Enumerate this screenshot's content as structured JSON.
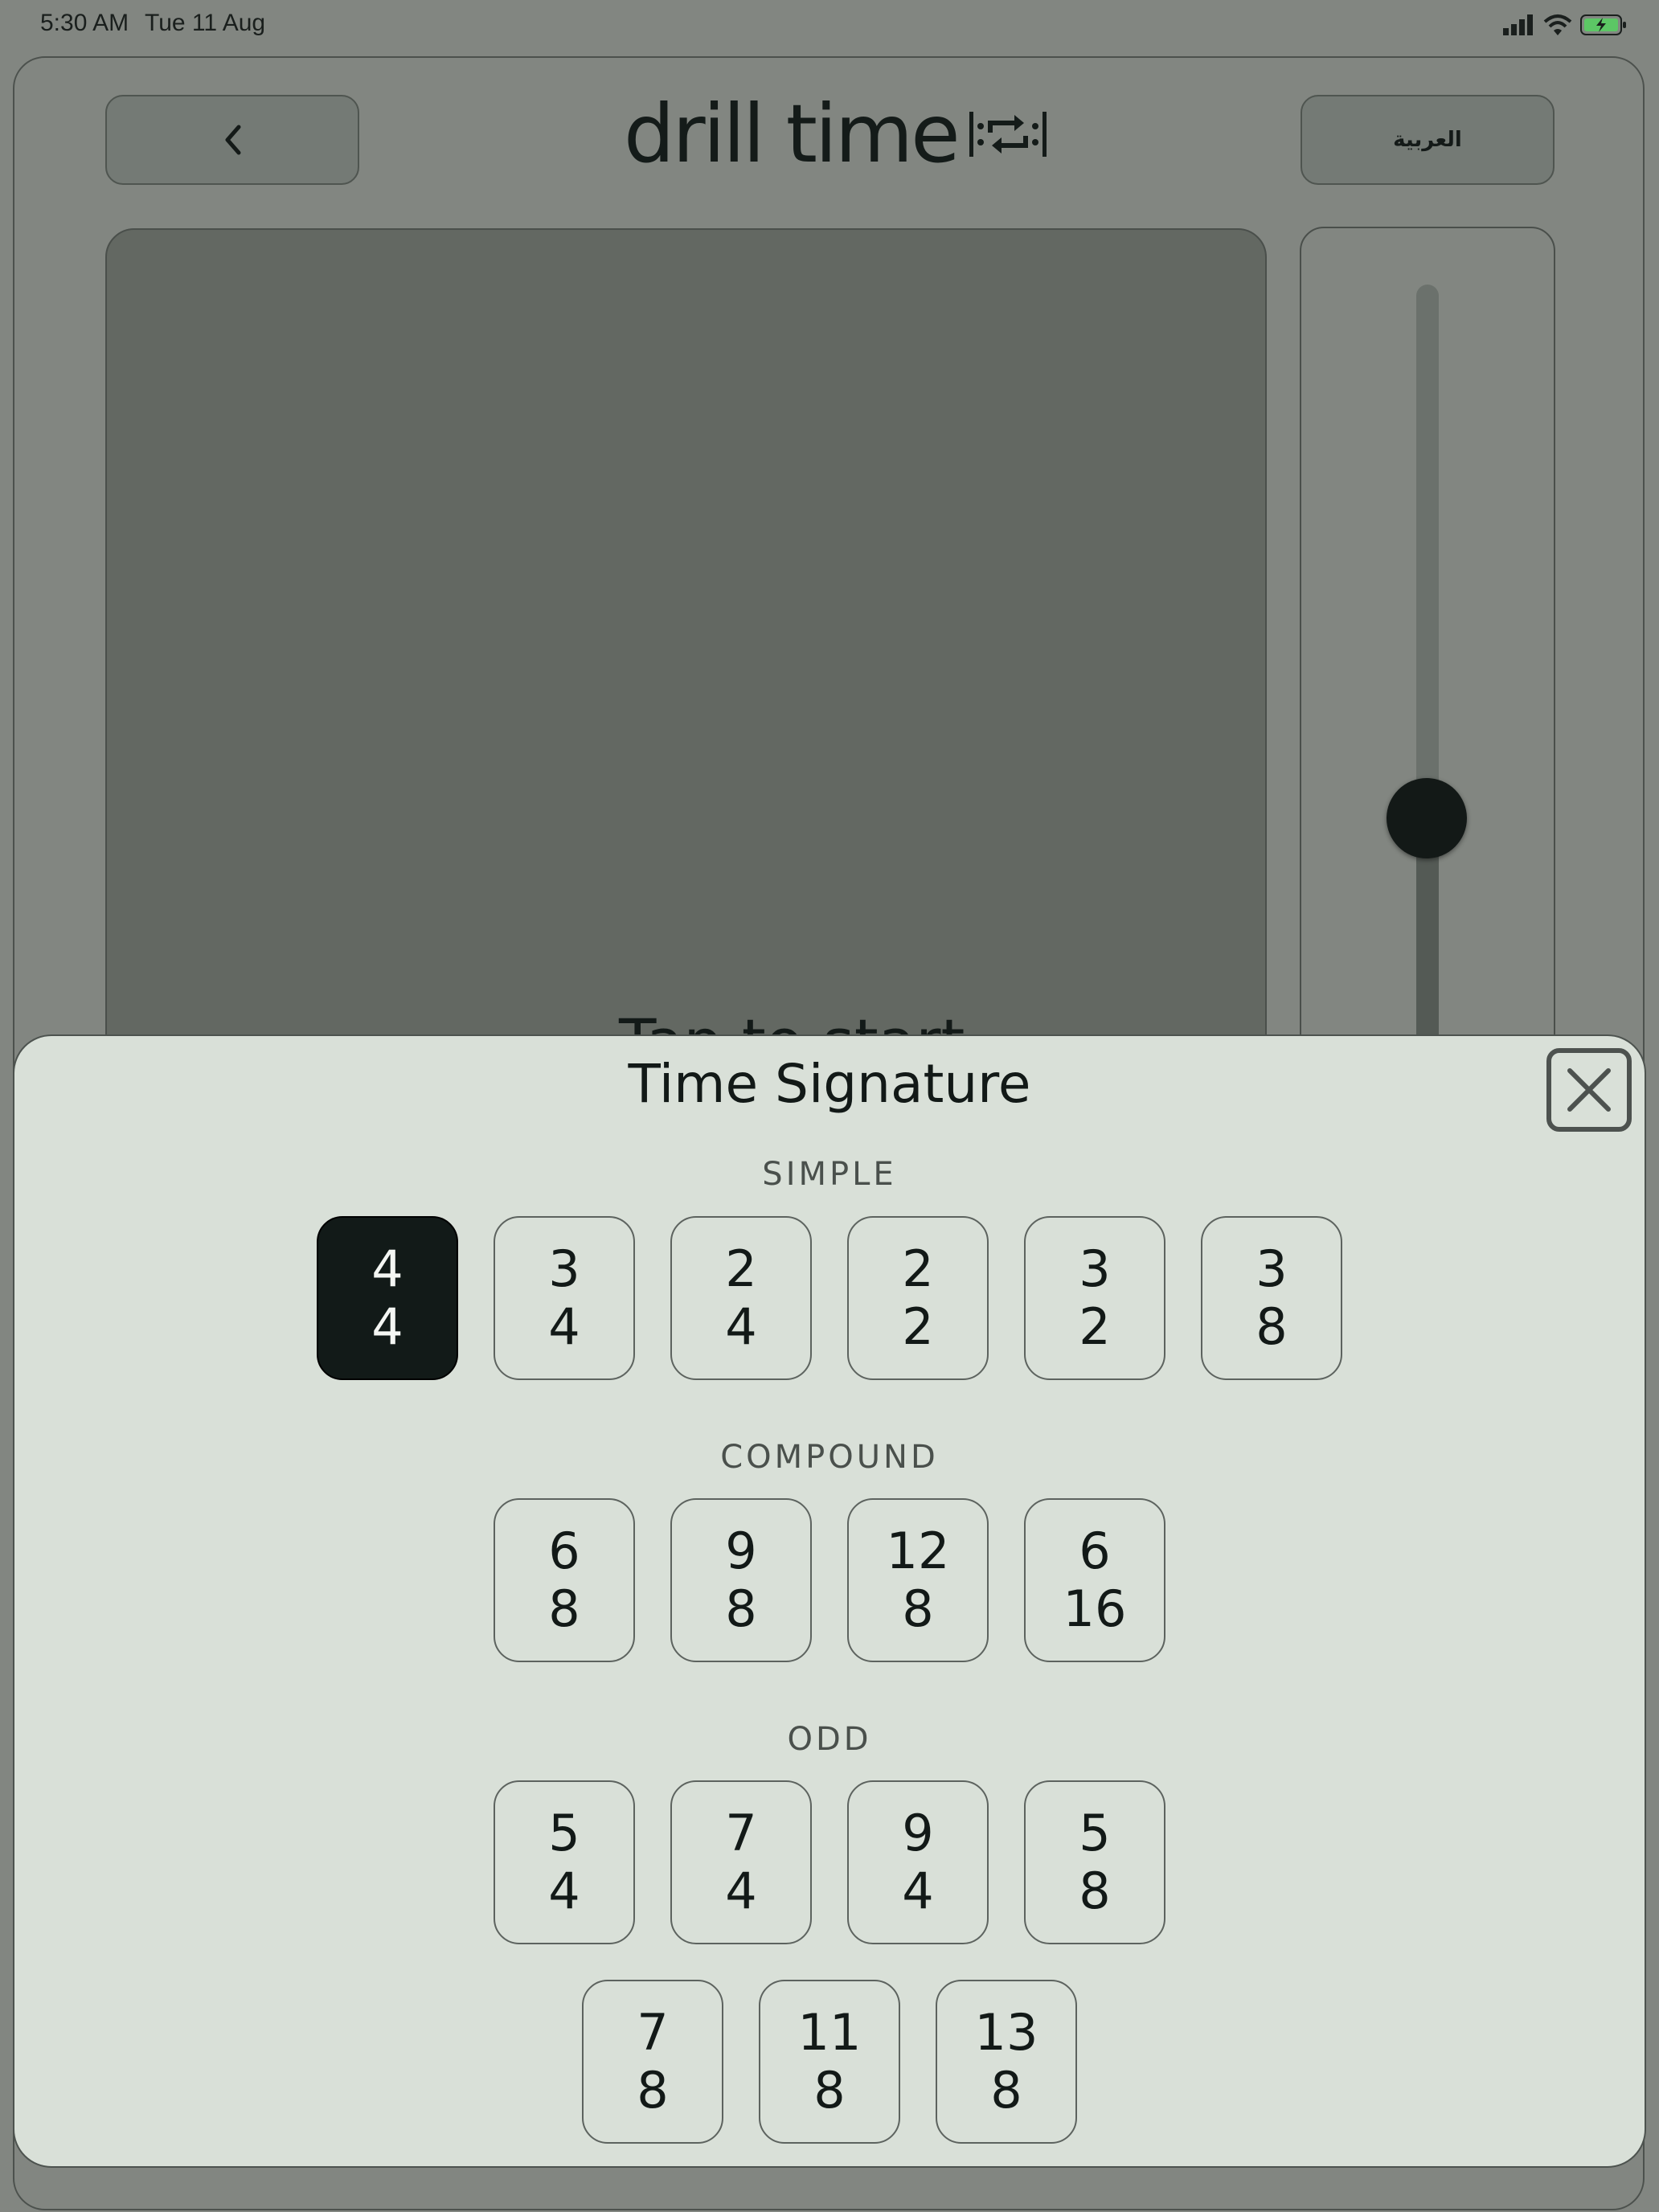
{
  "status": {
    "time": "5:30 AM",
    "date": "Tue 11 Aug"
  },
  "header": {
    "logo_text": "drill time",
    "language_label": "العربية"
  },
  "main": {
    "tap_label": "Tap to start",
    "tempo_slider_level": 0.5
  },
  "sheet": {
    "title": "Time Signature",
    "sections": [
      {
        "label": "SIMPLE",
        "items": [
          {
            "top": "4",
            "bottom": "4",
            "selected": true
          },
          {
            "top": "3",
            "bottom": "4"
          },
          {
            "top": "2",
            "bottom": "4"
          },
          {
            "top": "2",
            "bottom": "2"
          },
          {
            "top": "3",
            "bottom": "2"
          },
          {
            "top": "3",
            "bottom": "8"
          }
        ]
      },
      {
        "label": "COMPOUND",
        "items": [
          {
            "top": "6",
            "bottom": "8"
          },
          {
            "top": "9",
            "bottom": "8"
          },
          {
            "top": "12",
            "bottom": "8"
          },
          {
            "top": "6",
            "bottom": "16"
          }
        ]
      },
      {
        "label": "ODD",
        "items": [
          {
            "top": "5",
            "bottom": "4"
          },
          {
            "top": "7",
            "bottom": "4"
          },
          {
            "top": "9",
            "bottom": "4"
          },
          {
            "top": "5",
            "bottom": "8"
          },
          {
            "top": "7",
            "bottom": "8"
          },
          {
            "top": "11",
            "bottom": "8"
          },
          {
            "top": "13",
            "bottom": "8"
          }
        ]
      }
    ]
  },
  "colors": {
    "background_dim": "#828681",
    "sheet": "#d9e0d8",
    "selected": "#121a18",
    "battery": "#5cc765"
  }
}
